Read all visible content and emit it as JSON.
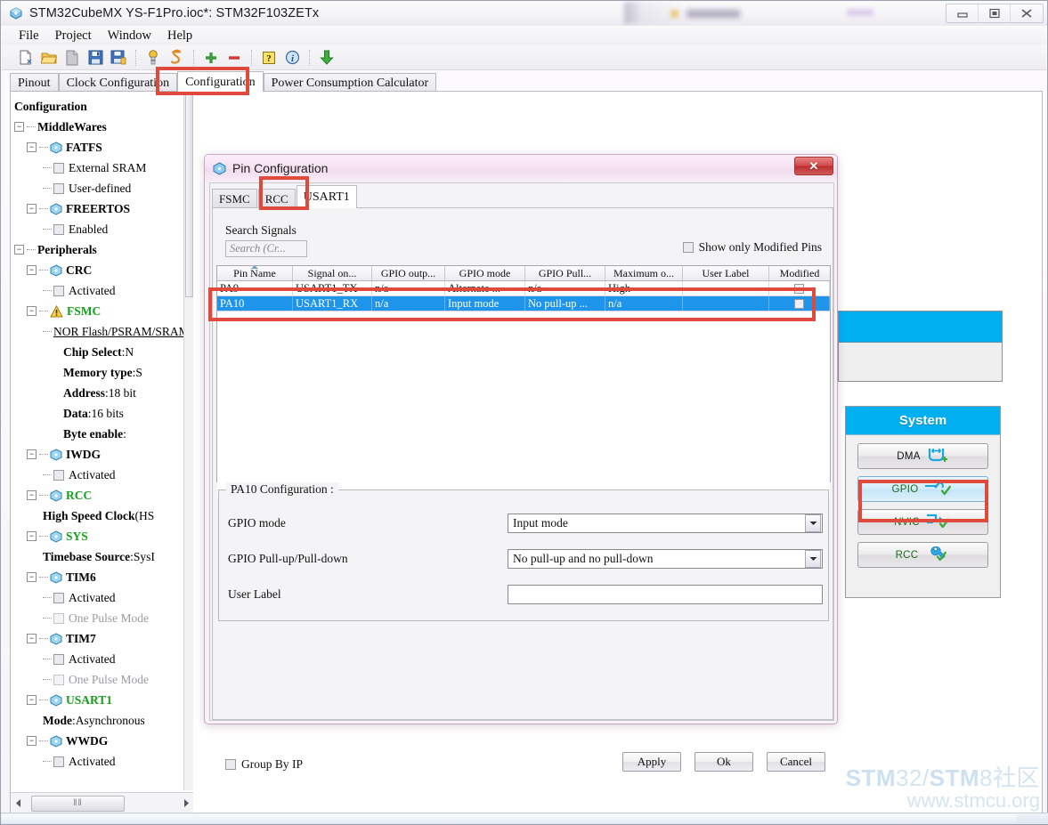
{
  "window": {
    "title": "STM32CubeMX YS-F1Pro.ioc*: STM32F103ZETx",
    "app_icon": "cube-icon",
    "minimize_label": "–",
    "maximize_label": "□",
    "close_label": "✕"
  },
  "menu": {
    "items": [
      "File",
      "Project",
      "Window",
      "Help"
    ]
  },
  "toolbar": {
    "icons": [
      "new-project-icon",
      "open-project-icon",
      "page-icon",
      "save-icon",
      "save-as-icon",
      "generate-code-icon",
      "report-icon",
      "add-icon",
      "remove-icon",
      "help-icon",
      "about-icon",
      "download-icon"
    ]
  },
  "main_tabs": [
    {
      "label": "Pinout",
      "active": false
    },
    {
      "label": "Clock Configuration",
      "active": false
    },
    {
      "label": "Configuration",
      "active": true
    },
    {
      "label": "Power Consumption Calculator",
      "active": false
    }
  ],
  "tree": {
    "root_label": "Configuration",
    "nodes": [
      {
        "indent": 0,
        "type": "group",
        "label": "MiddleWares",
        "style": "bold"
      },
      {
        "indent": 1,
        "type": "ip",
        "label": "FATFS",
        "style": "bold"
      },
      {
        "indent": 2,
        "type": "checkbox",
        "label": "External SRAM",
        "style": "plain",
        "checked": false
      },
      {
        "indent": 2,
        "type": "checkbox",
        "label": "User-defined",
        "style": "plain",
        "checked": false
      },
      {
        "indent": 1,
        "type": "ip",
        "label": "FREERTOS",
        "style": "bold"
      },
      {
        "indent": 2,
        "type": "checkbox",
        "label": "Enabled",
        "style": "plain",
        "checked": false
      },
      {
        "indent": 0,
        "type": "group",
        "label": "Peripherals",
        "style": "bold"
      },
      {
        "indent": 1,
        "type": "ip",
        "label": "CRC",
        "style": "bold"
      },
      {
        "indent": 2,
        "type": "checkbox",
        "label": "Activated",
        "style": "plain",
        "checked": false
      },
      {
        "indent": 1,
        "type": "ip-warn",
        "label": "FSMC",
        "style": "green"
      },
      {
        "indent": 2,
        "type": "link",
        "label": "NOR Flash/PSRAM/SRAM/RO"
      },
      {
        "indent": 3,
        "type": "kv",
        "key": "Chip Select",
        "value": ":N"
      },
      {
        "indent": 3,
        "type": "kv",
        "key": "Memory type",
        "value": ":S"
      },
      {
        "indent": 3,
        "type": "kv",
        "key": "Address",
        "value": ":18 bit"
      },
      {
        "indent": 3,
        "type": "kv",
        "key": "Data",
        "value": ":16 bits"
      },
      {
        "indent": 3,
        "type": "kv",
        "key": "Byte enable",
        "value": ":"
      },
      {
        "indent": 1,
        "type": "ip",
        "label": "IWDG",
        "style": "bold"
      },
      {
        "indent": 2,
        "type": "checkbox",
        "label": "Activated",
        "style": "plain",
        "checked": false
      },
      {
        "indent": 1,
        "type": "ip",
        "label": "RCC",
        "style": "green"
      },
      {
        "indent": 2,
        "type": "kv",
        "key": "High Speed Clock",
        "value": " (HS"
      },
      {
        "indent": 1,
        "type": "ip",
        "label": "SYS",
        "style": "green"
      },
      {
        "indent": 2,
        "type": "kv",
        "key": "Timebase Source",
        "value": ":SysI"
      },
      {
        "indent": 1,
        "type": "ip",
        "label": "TIM6",
        "style": "bold"
      },
      {
        "indent": 2,
        "type": "checkbox",
        "label": "Activated",
        "style": "plain",
        "checked": false
      },
      {
        "indent": 2,
        "type": "checkbox",
        "label": "One Pulse Mode",
        "style": "gray",
        "checked": false,
        "disabled": true
      },
      {
        "indent": 1,
        "type": "ip",
        "label": "TIM7",
        "style": "bold"
      },
      {
        "indent": 2,
        "type": "checkbox",
        "label": "Activated",
        "style": "plain",
        "checked": false
      },
      {
        "indent": 2,
        "type": "checkbox",
        "label": "One Pulse Mode",
        "style": "gray",
        "checked": false,
        "disabled": true
      },
      {
        "indent": 1,
        "type": "ip",
        "label": "USART1",
        "style": "green"
      },
      {
        "indent": 2,
        "type": "kv",
        "key": "Mode",
        "value": ":Asynchronous"
      },
      {
        "indent": 1,
        "type": "ip",
        "label": "WWDG",
        "style": "bold"
      },
      {
        "indent": 2,
        "type": "checkbox",
        "label": "Activated",
        "style": "plain",
        "checked": false
      }
    ]
  },
  "system_panel": {
    "title": "System",
    "buttons": [
      {
        "label": "DMA",
        "icon": "dma-icon",
        "selected": false,
        "check": false,
        "plus": true
      },
      {
        "label": "GPIO",
        "icon": "gpio-icon",
        "selected": true,
        "check": true,
        "plus": false
      },
      {
        "label": "NVIC",
        "icon": "nvic-icon",
        "selected": false,
        "check": true,
        "plus": false
      },
      {
        "label": "RCC",
        "icon": "wrench-icon",
        "selected": false,
        "check": true,
        "plus": false
      }
    ]
  },
  "dialog": {
    "title": "Pin Configuration",
    "close_label": "✕",
    "tabs": [
      {
        "label": "FSMC",
        "active": false
      },
      {
        "label": "RCC",
        "active": false
      },
      {
        "label": "USART1",
        "active": true
      }
    ],
    "search_label": "Search Signals",
    "search_placeholder": "Search (Cr...",
    "search_value": "",
    "modified_pins_label": "Show only Modified Pins",
    "modified_pins_checked": false,
    "table": {
      "columns": [
        "Pin Name",
        "Signal on...",
        "GPIO outp...",
        "GPIO mode",
        "GPIO Pull...",
        "Maximum o...",
        "User Label",
        "Modified"
      ],
      "sorted_column": 0,
      "rows": [
        {
          "selected": false,
          "cells": [
            "PA9",
            "USART1_TX",
            "n/a",
            "Alternate ...",
            "n/a",
            "High",
            ""
          ],
          "modified": false
        },
        {
          "selected": true,
          "cells": [
            "PA10",
            "USART1_RX",
            "n/a",
            "Input mode",
            "No pull-up ...",
            "n/a",
            ""
          ],
          "modified": false
        }
      ]
    },
    "pin_config": {
      "legend": "PA10 Configuration :",
      "fields": [
        {
          "label": "GPIO mode",
          "type": "combo",
          "value": "Input mode"
        },
        {
          "label": "GPIO Pull-up/Pull-down",
          "type": "combo",
          "value": "No pull-up and no pull-down"
        },
        {
          "label": "User Label",
          "type": "text",
          "value": ""
        }
      ]
    },
    "footer": {
      "group_by_ip_label": "Group By IP",
      "group_by_ip_checked": false,
      "buttons": [
        "Apply",
        "Ok",
        "Cancel"
      ]
    }
  },
  "annotations": {
    "highlight_color": "#e04a3c",
    "boxes": [
      "configuration-tab",
      "usart1-dialog-tab",
      "pin-table-rows",
      "gpio-ip-button"
    ]
  },
  "watermark": {
    "line1_a": "STM",
    "line1_b": "32/",
    "line1_c": "STM",
    "line1_d": "8社区",
    "line2": "www.stmcu.org"
  },
  "scrollbar": {
    "grip": "‖‖",
    "left_arrow": "◀",
    "right_arrow": "▶"
  }
}
